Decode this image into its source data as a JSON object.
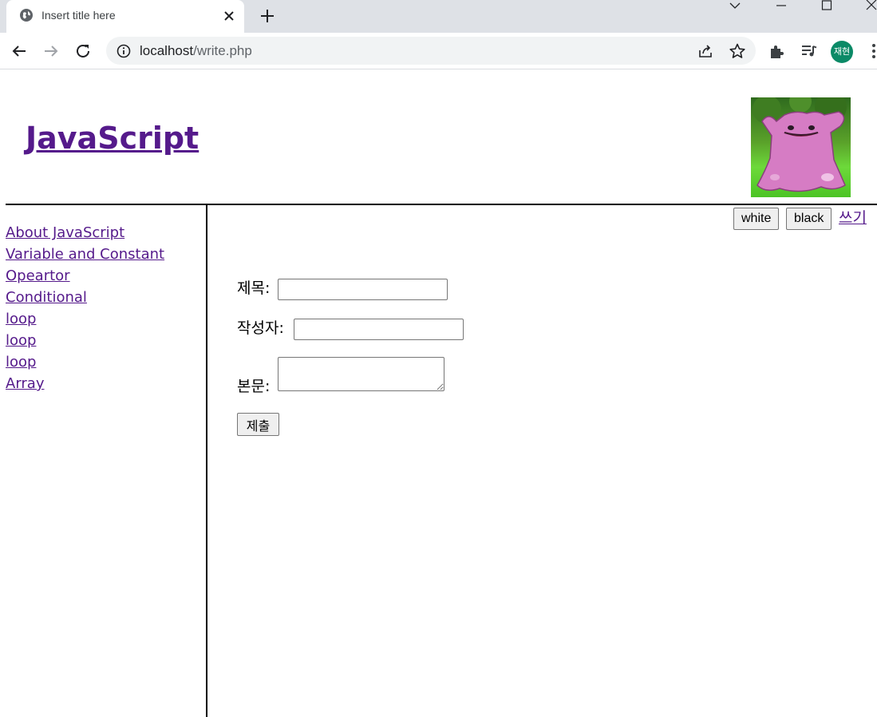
{
  "browser": {
    "tab_title": "Insert title here",
    "url_host": "localhost",
    "url_path": "/write.php",
    "profile_initials": "재현"
  },
  "colors": {
    "link_visited": "#551a8b",
    "avatar_bg": "#0b8a67",
    "tabstrip_bg": "#dee1e6",
    "omnibox_bg": "#f1f3f4"
  },
  "header": {
    "title": "JavaScript",
    "image_description": "ditto-pokemon-image"
  },
  "nav": {
    "items": [
      "About JavaScript",
      "Variable and Constant",
      "Opeartor",
      "Conditional",
      "loop",
      "loop",
      "loop",
      "Array"
    ]
  },
  "controls": {
    "white_label": "white",
    "black_label": "black",
    "write_link": "쓰기"
  },
  "form": {
    "title_label": "제목:",
    "title_value": "",
    "author_label": "작성자:",
    "author_value": "",
    "body_label": "본문:",
    "body_value": "",
    "submit_label": "제출"
  }
}
